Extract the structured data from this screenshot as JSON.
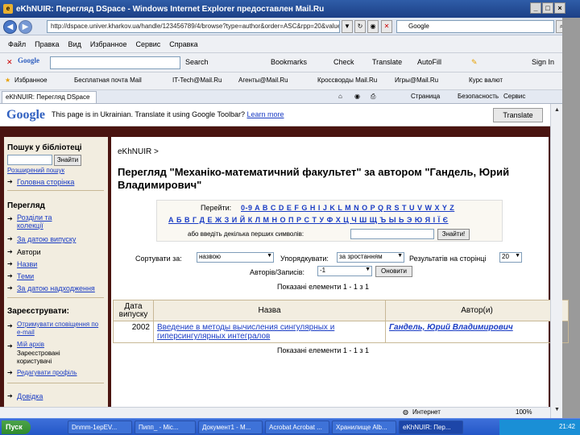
{
  "window": {
    "title": "eKhNUIR: Перегляд DSpace - Windows Internet Explorer предоставлен Mail.Ru",
    "minimize": "_",
    "maximize": "□",
    "close": "×"
  },
  "address_bar": {
    "url": "http://dspace.univer.kharkov.ua/handle/123456789/4/browse?type=author&order=ASC&rpp=20&value=",
    "search_value": "Google"
  },
  "menu": [
    "Файл",
    "Правка",
    "Вид",
    "Избранное",
    "Сервис",
    "Справка"
  ],
  "google_toolbar": {
    "logo": "Google",
    "search_label": "Search",
    "bookmarks": "Bookmarks",
    "check": "Check",
    "translate": "Translate",
    "autofill": "AutoFill",
    "sign_in": "Sign In"
  },
  "favorites": {
    "label": "Избранное",
    "items": [
      "Бесплатная почта Mail",
      "IT-Tech@Mail.Ru",
      "Агенты@Mail.Ru",
      "Кроссворды Mail.Ru",
      "Игры@Mail.Ru",
      "Курс валют"
    ]
  },
  "tab": {
    "label": "eKhNUIR: Перегляд DSpace"
  },
  "commands": {
    "page": "Страница",
    "safety": "Безопасность",
    "tools": "Сервис"
  },
  "translate_bar": {
    "logo": "Google",
    "message": "This page is in Ukrainian. Translate it using Google Toolbar?",
    "learn_more": "Learn more",
    "button": "Translate"
  },
  "sidebar": {
    "search_heading": "Пошук у бібліотеці",
    "search_button": "Знайти",
    "advanced_search": "Розширений пошук",
    "home": "Головна сторінка",
    "browse_heading": "Перегляд",
    "browse_items": [
      "Розділи та колекції",
      "За датою випуску",
      "Автори",
      "Назви",
      "Теми",
      "За датою надходження"
    ],
    "register_heading": "Зареєструвати:",
    "register_items": [
      "Отримувати сповіщення по e-mail",
      "Мій архів",
      "Зареєстровані користувачі",
      "Редагувати профіль",
      "Довідка"
    ]
  },
  "content": {
    "breadcrumb": "eKhNUIR >",
    "heading": "Перегляд \"Механіко-математичний факультет\" за автором \"Гандель, Юрий Владимирович\"",
    "goto_label": "Перейти:",
    "latin_letters": "0-9 A B C D E F G H I J K L M N O P Q R S T U V W X Y Z",
    "cyrillic_letters": "А Б В Г Д Е Ж З И Й К Л М Н О П Р С Т У Ф Х Ц Ч Ш Щ Ъ Ы Ь Э Ю Я І Ї Є",
    "first_chars_label": "або введіть декілька перших символів:",
    "find_button": "Знайти!",
    "sort_label": "Сортувати за:",
    "sort_value": "назвою",
    "order_label": "Упорядкувати:",
    "order_value": "за зростанням",
    "rpp_label": "Результатів на сторінці",
    "rpp_value": "20",
    "authors_label": "Авторів/Записів:",
    "authors_value": "-1",
    "update_button": "Оновити",
    "shown_top": "Показані елементи 1 - 1 з 1",
    "shown_bottom": "Показані елементи 1 - 1 з 1",
    "table": {
      "headers": [
        "Дата випуску",
        "Назва",
        "Автор(и)"
      ],
      "rows": [
        {
          "date": "2002",
          "title": "Введение в методы вычисления сингулярных и гиперсингулярных интегралов",
          "author": "Гандель, Юрий Владимирович"
        }
      ]
    }
  },
  "ie_status": {
    "zone": "Интернет",
    "zoom": "100%"
  },
  "taskbar": {
    "start": "Пуск",
    "tasks": [
      "Dnmm-1epEV...",
      "Пипп_ - Mic...",
      "Документ1 - M...",
      "Acrobat Acrobat ...",
      "Хранилище Alb...",
      "eKhNUIR: Пер..."
    ],
    "clock": "21:42"
  }
}
